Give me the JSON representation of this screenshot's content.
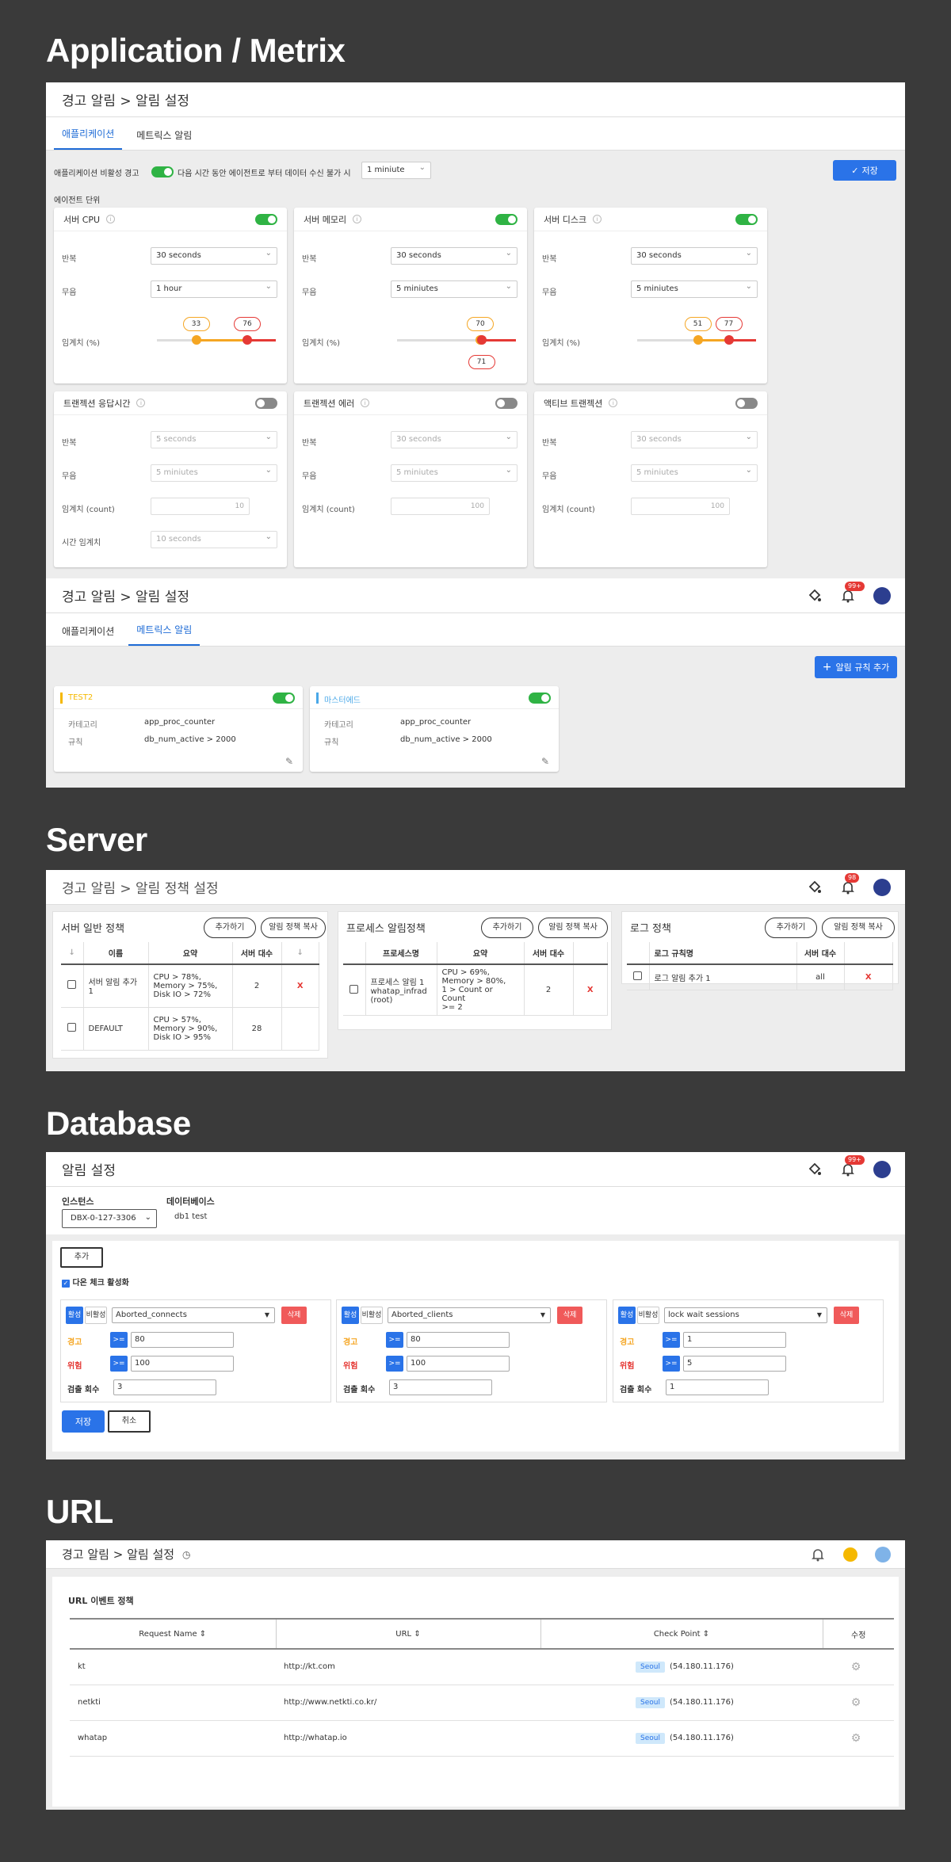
{
  "sections": {
    "application": "Application / Metrix",
    "server": "Server",
    "database": "Database",
    "url": "URL"
  },
  "app": {
    "title": "경고 알림 > 알림 설정",
    "tabs": [
      "애플리케이션",
      "메트릭스 알림"
    ],
    "inactive_label": "애플리케이션 비활성 경고",
    "inactive_desc": "다음 시간 동안 에이전트로 부터 데이터 수신 불가 시",
    "inactive_value": "1 miniute",
    "save": "저장",
    "agent_unit": "에이전트 단위",
    "labels": {
      "repeat": "반복",
      "mute": "무음",
      "threshold_pct": "임계치 (%)",
      "threshold_count": "임계치 (count)",
      "time_threshold": "시간 임계치"
    },
    "cards_top": [
      {
        "title": "서버 CPU",
        "repeat": "30 seconds",
        "mute": "1 hour",
        "warn": 33,
        "crit": 76
      },
      {
        "title": "서버 메모리",
        "repeat": "30 seconds",
        "mute": "5 miniutes",
        "warn": 70,
        "crit": 71
      },
      {
        "title": "서버 디스크",
        "repeat": "30 seconds",
        "mute": "5 miniutes",
        "warn": 51,
        "crit": 77
      }
    ],
    "cards_bottom": [
      {
        "title": "트랜젝션 응답시간",
        "repeat": "5 seconds",
        "mute": "5 miniutes",
        "count": "10",
        "time": "10 seconds"
      },
      {
        "title": "트랜젝션 에러",
        "repeat": "30 seconds",
        "mute": "5 miniutes",
        "count": "100"
      },
      {
        "title": "액티브 트랜젝션",
        "repeat": "30 seconds",
        "mute": "5 miniutes",
        "count": "100"
      }
    ]
  },
  "metrix": {
    "title": "경고 알림 > 알림 설정",
    "tabs": [
      "애플리케이션",
      "메트릭스 알림"
    ],
    "badge": "99+",
    "add_rule": "알림 규칙 추가",
    "category_label": "카테고리",
    "rule_label": "규칙",
    "rules": [
      {
        "name": "TEST2",
        "category": "app_proc_counter",
        "rule": "db_num_active > 2000",
        "color": "#f5b800"
      },
      {
        "name": "마스터에드",
        "category": "app_proc_counter",
        "rule": "db_num_active > 2000",
        "color": "#4aa8e8"
      }
    ]
  },
  "server": {
    "title": "경고 알림 > 알림 정책 설정",
    "badge": "98",
    "add": "추가하기",
    "copy": "알림 정책 복사",
    "general": {
      "title": "서버 일반 정책",
      "headers": [
        "이름",
        "요약",
        "서버 대수"
      ],
      "rows": [
        {
          "name": "서버 알림 추가 1",
          "summary": "CPU > 78%,\nMemory > 75%,\nDisk IO > 72%",
          "count": "2",
          "del": "X"
        },
        {
          "name": "DEFAULT",
          "summary": "CPU > 57%,\nMemory > 90%,\nDisk IO > 95%",
          "count": "28",
          "del": ""
        }
      ]
    },
    "process": {
      "title": "프로세스 알림정책",
      "headers": [
        "프로세스명",
        "요약",
        "서버 대수"
      ],
      "rows": [
        {
          "name": "프로세스 알림 1\nwhatap_infrad\n(root)",
          "summary": "CPU > 69%,\nMemory > 80%,\n1 > Count or Count\n>= 2",
          "count": "2",
          "del": "X"
        }
      ]
    },
    "log": {
      "title": "로그 정책",
      "headers": [
        "로그 규칙명",
        "서버 대수"
      ],
      "rows": [
        {
          "name": "로그 알림 추가 1",
          "count": "all",
          "del": "X"
        }
      ]
    }
  },
  "database": {
    "title": "알림 설정",
    "badge": "99+",
    "instance_label": "인스턴스",
    "instance_value": "DBX-0-127-3306",
    "db_label": "데이터베이스",
    "db_value": "db1 test",
    "add": "추가",
    "multi_check": "다온 체크 활성화",
    "active": "활성",
    "inactive": "비활성",
    "delete": "삭제",
    "warn_label": "경고",
    "crit_label": "위험",
    "detect_label": "검출 회수",
    "op": ">=",
    "save": "저장",
    "cancel": "취소",
    "rules": [
      {
        "metric": "Aborted_connects",
        "warn": "80",
        "crit": "100",
        "detect": "3"
      },
      {
        "metric": "Aborted_clients",
        "warn": "80",
        "crit": "100",
        "detect": "3"
      },
      {
        "metric": "lock wait sessions",
        "warn": "1",
        "crit": "5",
        "detect": "1"
      }
    ]
  },
  "url": {
    "title": "경고 알림 > 알림 설정",
    "policy_title": "URL 이벤트 정책",
    "headers": [
      "Request Name",
      "URL",
      "Check Point",
      "수정"
    ],
    "rows": [
      {
        "name": "kt",
        "url": "http://kt.com",
        "region": "Seoul",
        "ip": "(54.180.11.176)"
      },
      {
        "name": "netkti",
        "url": "http://www.netkti.co.kr/",
        "region": "Seoul",
        "ip": "(54.180.11.176)"
      },
      {
        "name": "whatap",
        "url": "http://whatap.io",
        "region": "Seoul",
        "ip": "(54.180.11.176)"
      }
    ]
  },
  "colors": {
    "accent": "#2a73e8",
    "on": "#2fb344",
    "warn": "#f5a623",
    "crit": "#e53935"
  }
}
